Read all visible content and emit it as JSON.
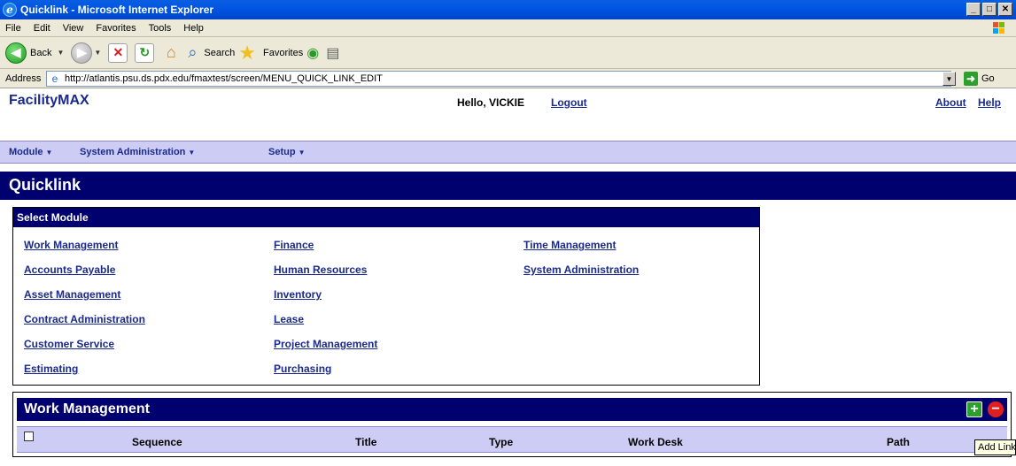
{
  "window": {
    "title": "Quicklink - Microsoft Internet Explorer",
    "buttons": {
      "minimize": "_",
      "maximize": "□",
      "close": "✕"
    }
  },
  "menu": {
    "items": [
      {
        "label": "File"
      },
      {
        "label": "Edit"
      },
      {
        "label": "View"
      },
      {
        "label": "Favorites"
      },
      {
        "label": "Tools"
      },
      {
        "label": "Help"
      }
    ]
  },
  "toolbar": {
    "back_label": "Back",
    "search_label": "Search",
    "favorites_label": "Favorites"
  },
  "address": {
    "label": "Address",
    "url": "http://atlantis.psu.ds.pdx.edu/fmaxtest/screen/MENU_QUICK_LINK_EDIT",
    "go_label": "Go"
  },
  "app": {
    "brand": "FacilityMAX",
    "greeting": "Hello, VICKIE",
    "logout": "Logout",
    "about": "About",
    "help": "Help"
  },
  "nav": {
    "items": [
      {
        "label": "Module"
      },
      {
        "label": "System Administration"
      },
      {
        "label": "Setup"
      }
    ]
  },
  "page": {
    "title": "Quicklink"
  },
  "select_module": {
    "header": "Select Module",
    "columns": [
      [
        "Work Management",
        "Accounts Payable",
        "Asset Management",
        "Contract Administration",
        "Customer Service",
        "Estimating"
      ],
      [
        "Finance",
        "Human Resources",
        "Inventory",
        "Lease",
        "Project Management",
        "Purchasing"
      ],
      [
        "Time Management",
        "System Administration"
      ]
    ]
  },
  "work_management": {
    "header": "Work Management",
    "columns": [
      "Sequence",
      "Title",
      "Type",
      "Work Desk",
      "Path"
    ]
  },
  "tooltip": {
    "text": "Add Link"
  },
  "colors": {
    "navy": "#00006e",
    "nav_bg": "#ccccf4",
    "link": "#1a2a8c",
    "xp_blue": "#0055e5"
  }
}
